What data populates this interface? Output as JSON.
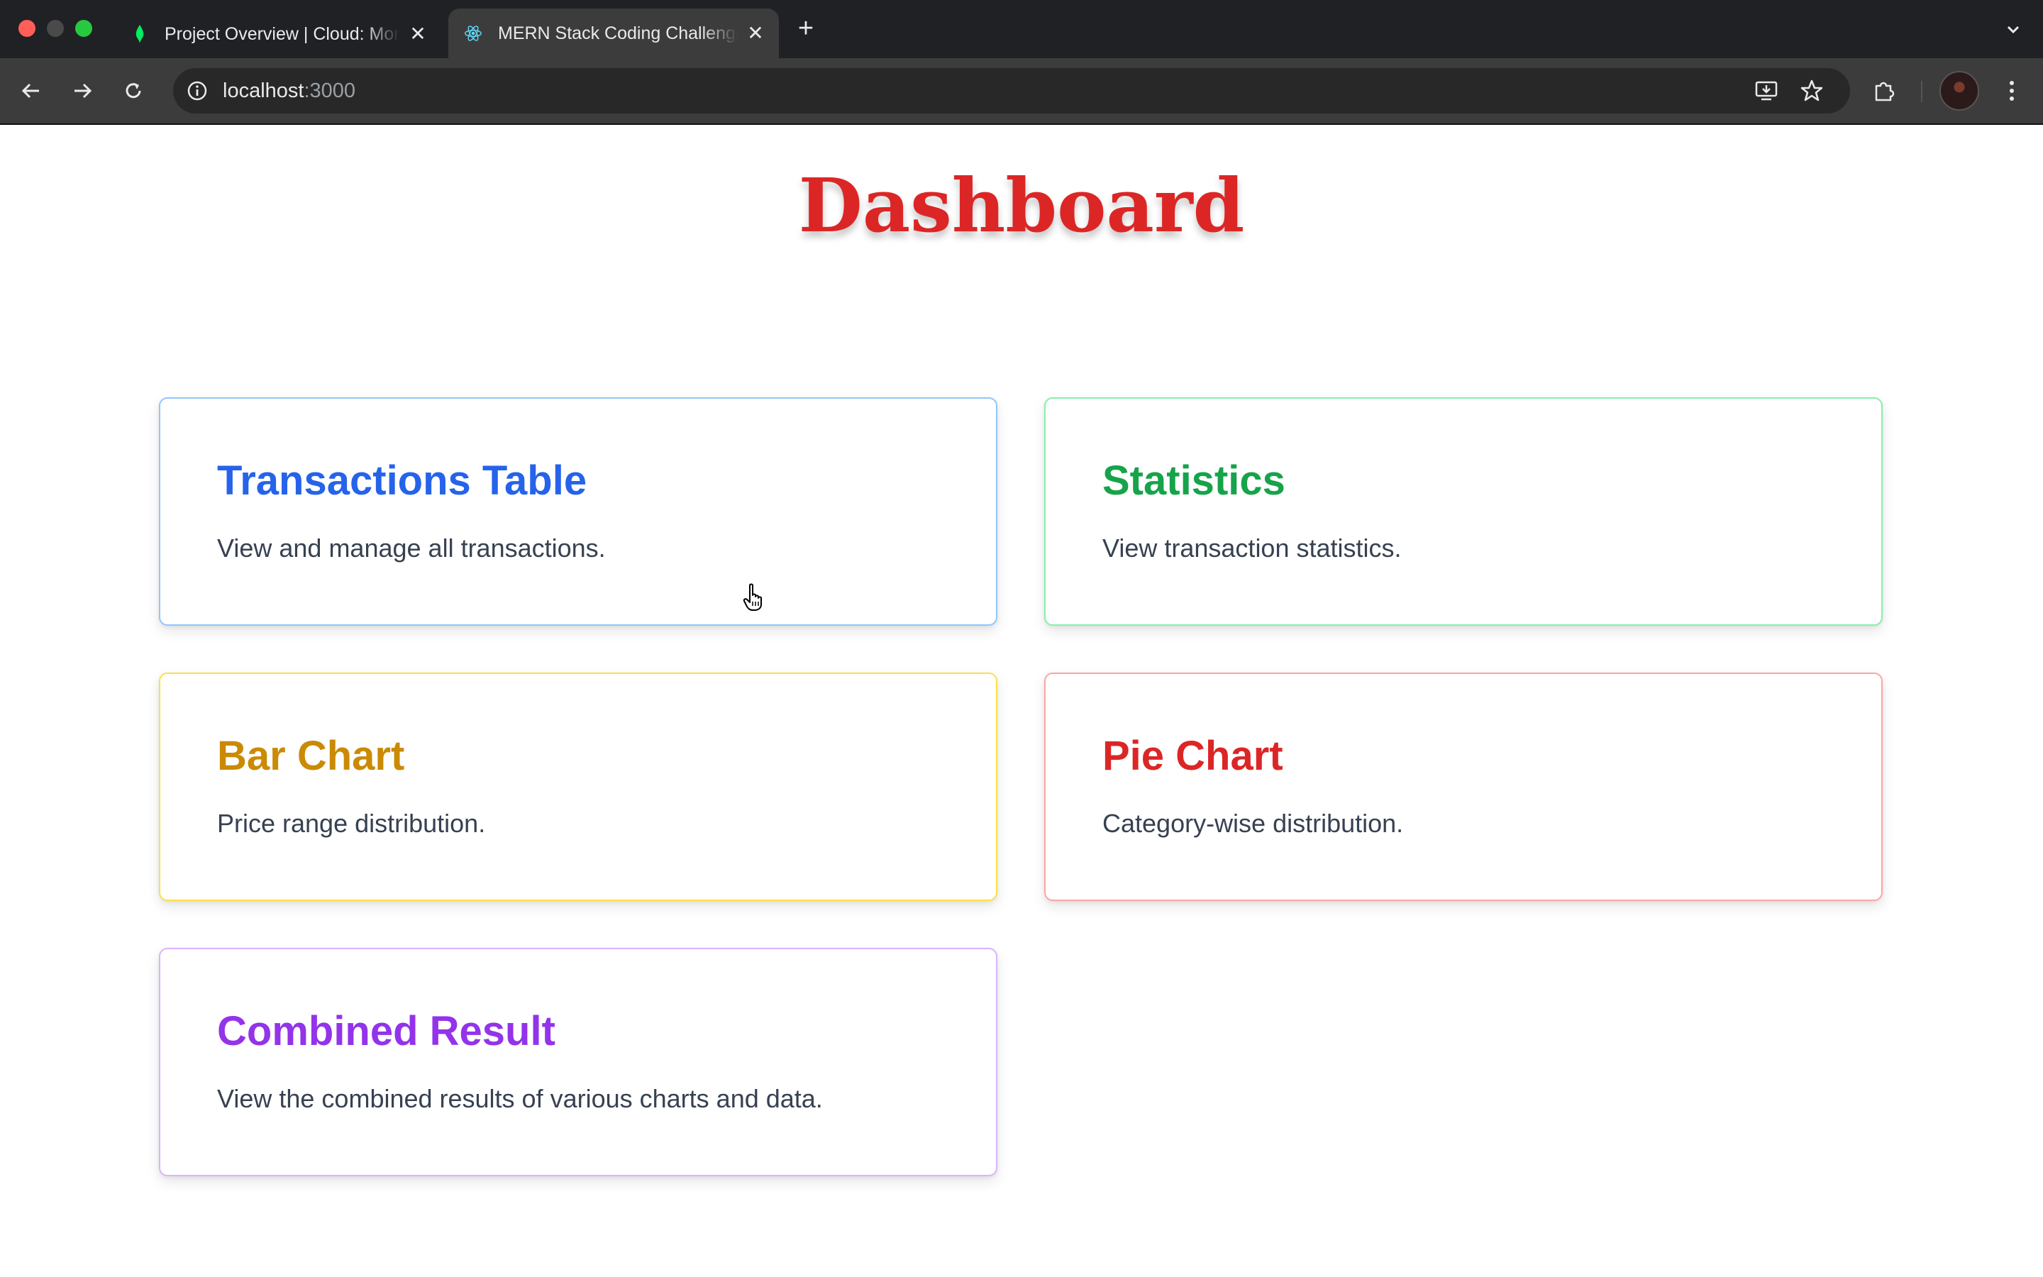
{
  "browser": {
    "tabs": [
      {
        "title": "Project Overview | Cloud: MongoDB Cloud",
        "active": false,
        "favicon": "mongodb-leaf-icon"
      },
      {
        "title": "MERN Stack Coding Challenge",
        "active": true,
        "favicon": "react-atom-icon"
      }
    ],
    "address": {
      "host": "localhost",
      "port": ":3000"
    }
  },
  "page": {
    "title": "Dashboard",
    "cards": [
      {
        "title": "Transactions Table",
        "description": "View and manage all transactions.",
        "color": "#2563eb",
        "border": "#93c5fd"
      },
      {
        "title": "Statistics",
        "description": "View transaction statistics.",
        "color": "#16a34a",
        "border": "#86efac"
      },
      {
        "title": "Bar Chart",
        "description": "Price range distribution.",
        "color": "#ca8a04",
        "border": "#fde047"
      },
      {
        "title": "Pie Chart",
        "description": "Category-wise distribution.",
        "color": "#dc2626",
        "border": "#fca5a5"
      },
      {
        "title": "Combined Result",
        "description": "View the combined results of various charts and data.",
        "color": "#9333ea",
        "border": "#d8b4fe"
      }
    ]
  }
}
